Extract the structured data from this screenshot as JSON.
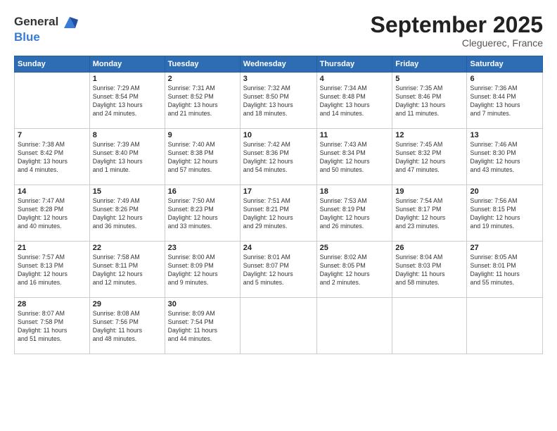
{
  "logo": {
    "general": "General",
    "blue": "Blue"
  },
  "title": "September 2025",
  "location": "Cleguerec, France",
  "days_header": [
    "Sunday",
    "Monday",
    "Tuesday",
    "Wednesday",
    "Thursday",
    "Friday",
    "Saturday"
  ],
  "weeks": [
    [
      {
        "day": "",
        "info": ""
      },
      {
        "day": "1",
        "info": "Sunrise: 7:29 AM\nSunset: 8:54 PM\nDaylight: 13 hours\nand 24 minutes."
      },
      {
        "day": "2",
        "info": "Sunrise: 7:31 AM\nSunset: 8:52 PM\nDaylight: 13 hours\nand 21 minutes."
      },
      {
        "day": "3",
        "info": "Sunrise: 7:32 AM\nSunset: 8:50 PM\nDaylight: 13 hours\nand 18 minutes."
      },
      {
        "day": "4",
        "info": "Sunrise: 7:34 AM\nSunset: 8:48 PM\nDaylight: 13 hours\nand 14 minutes."
      },
      {
        "day": "5",
        "info": "Sunrise: 7:35 AM\nSunset: 8:46 PM\nDaylight: 13 hours\nand 11 minutes."
      },
      {
        "day": "6",
        "info": "Sunrise: 7:36 AM\nSunset: 8:44 PM\nDaylight: 13 hours\nand 7 minutes."
      }
    ],
    [
      {
        "day": "7",
        "info": "Sunrise: 7:38 AM\nSunset: 8:42 PM\nDaylight: 13 hours\nand 4 minutes."
      },
      {
        "day": "8",
        "info": "Sunrise: 7:39 AM\nSunset: 8:40 PM\nDaylight: 13 hours\nand 1 minute."
      },
      {
        "day": "9",
        "info": "Sunrise: 7:40 AM\nSunset: 8:38 PM\nDaylight: 12 hours\nand 57 minutes."
      },
      {
        "day": "10",
        "info": "Sunrise: 7:42 AM\nSunset: 8:36 PM\nDaylight: 12 hours\nand 54 minutes."
      },
      {
        "day": "11",
        "info": "Sunrise: 7:43 AM\nSunset: 8:34 PM\nDaylight: 12 hours\nand 50 minutes."
      },
      {
        "day": "12",
        "info": "Sunrise: 7:45 AM\nSunset: 8:32 PM\nDaylight: 12 hours\nand 47 minutes."
      },
      {
        "day": "13",
        "info": "Sunrise: 7:46 AM\nSunset: 8:30 PM\nDaylight: 12 hours\nand 43 minutes."
      }
    ],
    [
      {
        "day": "14",
        "info": "Sunrise: 7:47 AM\nSunset: 8:28 PM\nDaylight: 12 hours\nand 40 minutes."
      },
      {
        "day": "15",
        "info": "Sunrise: 7:49 AM\nSunset: 8:26 PM\nDaylight: 12 hours\nand 36 minutes."
      },
      {
        "day": "16",
        "info": "Sunrise: 7:50 AM\nSunset: 8:23 PM\nDaylight: 12 hours\nand 33 minutes."
      },
      {
        "day": "17",
        "info": "Sunrise: 7:51 AM\nSunset: 8:21 PM\nDaylight: 12 hours\nand 29 minutes."
      },
      {
        "day": "18",
        "info": "Sunrise: 7:53 AM\nSunset: 8:19 PM\nDaylight: 12 hours\nand 26 minutes."
      },
      {
        "day": "19",
        "info": "Sunrise: 7:54 AM\nSunset: 8:17 PM\nDaylight: 12 hours\nand 23 minutes."
      },
      {
        "day": "20",
        "info": "Sunrise: 7:56 AM\nSunset: 8:15 PM\nDaylight: 12 hours\nand 19 minutes."
      }
    ],
    [
      {
        "day": "21",
        "info": "Sunrise: 7:57 AM\nSunset: 8:13 PM\nDaylight: 12 hours\nand 16 minutes."
      },
      {
        "day": "22",
        "info": "Sunrise: 7:58 AM\nSunset: 8:11 PM\nDaylight: 12 hours\nand 12 minutes."
      },
      {
        "day": "23",
        "info": "Sunrise: 8:00 AM\nSunset: 8:09 PM\nDaylight: 12 hours\nand 9 minutes."
      },
      {
        "day": "24",
        "info": "Sunrise: 8:01 AM\nSunset: 8:07 PM\nDaylight: 12 hours\nand 5 minutes."
      },
      {
        "day": "25",
        "info": "Sunrise: 8:02 AM\nSunset: 8:05 PM\nDaylight: 12 hours\nand 2 minutes."
      },
      {
        "day": "26",
        "info": "Sunrise: 8:04 AM\nSunset: 8:03 PM\nDaylight: 11 hours\nand 58 minutes."
      },
      {
        "day": "27",
        "info": "Sunrise: 8:05 AM\nSunset: 8:01 PM\nDaylight: 11 hours\nand 55 minutes."
      }
    ],
    [
      {
        "day": "28",
        "info": "Sunrise: 8:07 AM\nSunset: 7:58 PM\nDaylight: 11 hours\nand 51 minutes."
      },
      {
        "day": "29",
        "info": "Sunrise: 8:08 AM\nSunset: 7:56 PM\nDaylight: 11 hours\nand 48 minutes."
      },
      {
        "day": "30",
        "info": "Sunrise: 8:09 AM\nSunset: 7:54 PM\nDaylight: 11 hours\nand 44 minutes."
      },
      {
        "day": "",
        "info": ""
      },
      {
        "day": "",
        "info": ""
      },
      {
        "day": "",
        "info": ""
      },
      {
        "day": "",
        "info": ""
      }
    ]
  ]
}
